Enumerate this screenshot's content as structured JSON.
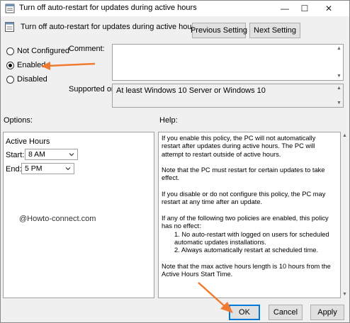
{
  "window": {
    "title": "Turn off auto-restart for updates during active hours",
    "controls": {
      "minimize": "—",
      "maximize": "☐",
      "close": "✕"
    }
  },
  "header": {
    "policy_title": "Turn off auto-restart for updates during active hours",
    "previous_button": "Previous Setting",
    "next_button": "Next Setting"
  },
  "state": {
    "options": [
      {
        "label": "Not Configured",
        "checked": false
      },
      {
        "label": "Enabled",
        "checked": true
      },
      {
        "label": "Disabled",
        "checked": false
      }
    ]
  },
  "comment": {
    "label": "Comment:",
    "value": ""
  },
  "supported": {
    "label": "Supported on:",
    "value": "At least Windows 10 Server or Windows 10"
  },
  "options_section": {
    "heading": "Options:",
    "group_title": "Active Hours",
    "start_label": "Start:",
    "start_value": "8 AM",
    "end_label": "End:",
    "end_value": "5 PM"
  },
  "help_section": {
    "heading": "Help:",
    "paragraphs": {
      "p1": "If you enable this policy, the PC will not automatically restart after updates during active hours. The PC will attempt to restart outside of active hours.",
      "p2": "Note that the PC must restart for certain updates to take effect.",
      "p3": "If you disable or do not configure this policy, the PC may restart at any time after an update.",
      "p4": "If any of the following two policies are enabled, this policy has no effect:",
      "p4_item1": "1. No auto-restart with logged on users for scheduled automatic updates installations.",
      "p4_item2": "2. Always automatically restart at scheduled time.",
      "p5": "Note that the max active hours length is 10 hours from the Active Hours Start Time."
    }
  },
  "footer": {
    "ok": "OK",
    "cancel": "Cancel",
    "apply": "Apply"
  },
  "watermark": "@Howto-connect.com",
  "colors": {
    "annotation_arrow": "#f07a30",
    "default_button_border": "#0078d7"
  }
}
